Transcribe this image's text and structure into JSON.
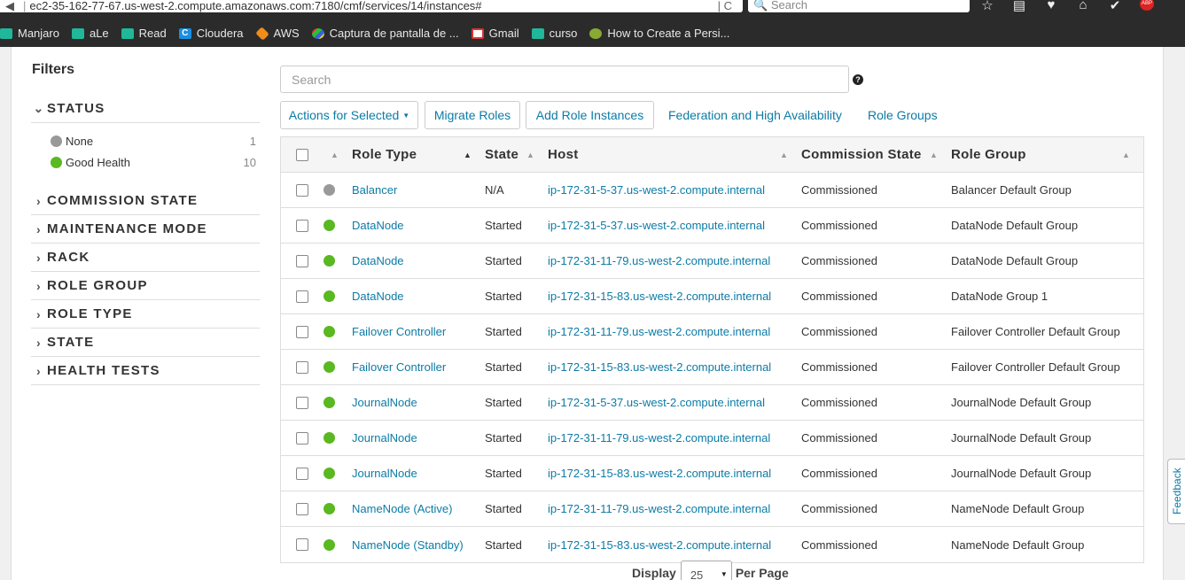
{
  "browser": {
    "url": "ec2-35-162-77-67.us-west-2.compute.amazonaws.com:7180/cmf/services/14/instances#",
    "search_placeholder": "Search",
    "abp_label": "ABP"
  },
  "bookmarks": [
    {
      "label": "Manjaro",
      "icon": "folder-icon"
    },
    {
      "label": "aLe",
      "icon": "folder-icon"
    },
    {
      "label": "Read",
      "icon": "folder-icon"
    },
    {
      "label": "Cloudera",
      "icon": "cloudera-icon"
    },
    {
      "label": "AWS",
      "icon": "aws-icon"
    },
    {
      "label": "Captura de pantalla de ...",
      "icon": "captura-icon"
    },
    {
      "label": "Gmail",
      "icon": "gmail-icon"
    },
    {
      "label": "curso",
      "icon": "folder-icon"
    },
    {
      "label": "How to Create a Persi...",
      "icon": "persi-icon"
    }
  ],
  "filters": {
    "title": "Filters",
    "status": {
      "label": "STATUS",
      "items": [
        {
          "label": "None",
          "count": "1",
          "color": "#999999"
        },
        {
          "label": "Good Health",
          "count": "10",
          "color": "#5ab820"
        }
      ]
    },
    "sections": [
      "COMMISSION STATE",
      "MAINTENANCE MODE",
      "RACK",
      "ROLE GROUP",
      "ROLE TYPE",
      "STATE",
      "HEALTH TESTS"
    ]
  },
  "search": {
    "placeholder": "Search"
  },
  "actions": {
    "actions_for_selected": "Actions for Selected",
    "migrate_roles": "Migrate Roles",
    "add_role_instances": "Add Role Instances",
    "federation": "Federation and High Availability",
    "role_groups": "Role Groups"
  },
  "table": {
    "columns": [
      "Role Type",
      "State",
      "Host",
      "Commission State",
      "Role Group"
    ],
    "rows": [
      {
        "status": "none",
        "role_type": "Balancer",
        "state": "N/A",
        "host": "ip-172-31-5-37.us-west-2.compute.internal",
        "commission": "Commissioned",
        "role_group": "Balancer Default Group"
      },
      {
        "status": "good",
        "role_type": "DataNode",
        "state": "Started",
        "host": "ip-172-31-5-37.us-west-2.compute.internal",
        "commission": "Commissioned",
        "role_group": "DataNode Default Group"
      },
      {
        "status": "good",
        "role_type": "DataNode",
        "state": "Started",
        "host": "ip-172-31-11-79.us-west-2.compute.internal",
        "commission": "Commissioned",
        "role_group": "DataNode Default Group"
      },
      {
        "status": "good",
        "role_type": "DataNode",
        "state": "Started",
        "host": "ip-172-31-15-83.us-west-2.compute.internal",
        "commission": "Commissioned",
        "role_group": "DataNode Group 1"
      },
      {
        "status": "good",
        "role_type": "Failover Controller",
        "state": "Started",
        "host": "ip-172-31-11-79.us-west-2.compute.internal",
        "commission": "Commissioned",
        "role_group": "Failover Controller Default Group"
      },
      {
        "status": "good",
        "role_type": "Failover Controller",
        "state": "Started",
        "host": "ip-172-31-15-83.us-west-2.compute.internal",
        "commission": "Commissioned",
        "role_group": "Failover Controller Default Group"
      },
      {
        "status": "good",
        "role_type": "JournalNode",
        "state": "Started",
        "host": "ip-172-31-5-37.us-west-2.compute.internal",
        "commission": "Commissioned",
        "role_group": "JournalNode Default Group"
      },
      {
        "status": "good",
        "role_type": "JournalNode",
        "state": "Started",
        "host": "ip-172-31-11-79.us-west-2.compute.internal",
        "commission": "Commissioned",
        "role_group": "JournalNode Default Group"
      },
      {
        "status": "good",
        "role_type": "JournalNode",
        "state": "Started",
        "host": "ip-172-31-15-83.us-west-2.compute.internal",
        "commission": "Commissioned",
        "role_group": "JournalNode Default Group"
      },
      {
        "status": "good",
        "role_type": "NameNode (Active)",
        "state": "Started",
        "host": "ip-172-31-11-79.us-west-2.compute.internal",
        "commission": "Commissioned",
        "role_group": "NameNode Default Group"
      },
      {
        "status": "good",
        "role_type": "NameNode (Standby)",
        "state": "Started",
        "host": "ip-172-31-15-83.us-west-2.compute.internal",
        "commission": "Commissioned",
        "role_group": "NameNode Default Group"
      }
    ]
  },
  "pager": {
    "display": "Display",
    "per_page_value": "25",
    "per_page": "Per Page"
  },
  "feedback": "Feedback",
  "colors": {
    "link": "#0c7ba6",
    "good": "#5ab820",
    "none": "#999999"
  }
}
